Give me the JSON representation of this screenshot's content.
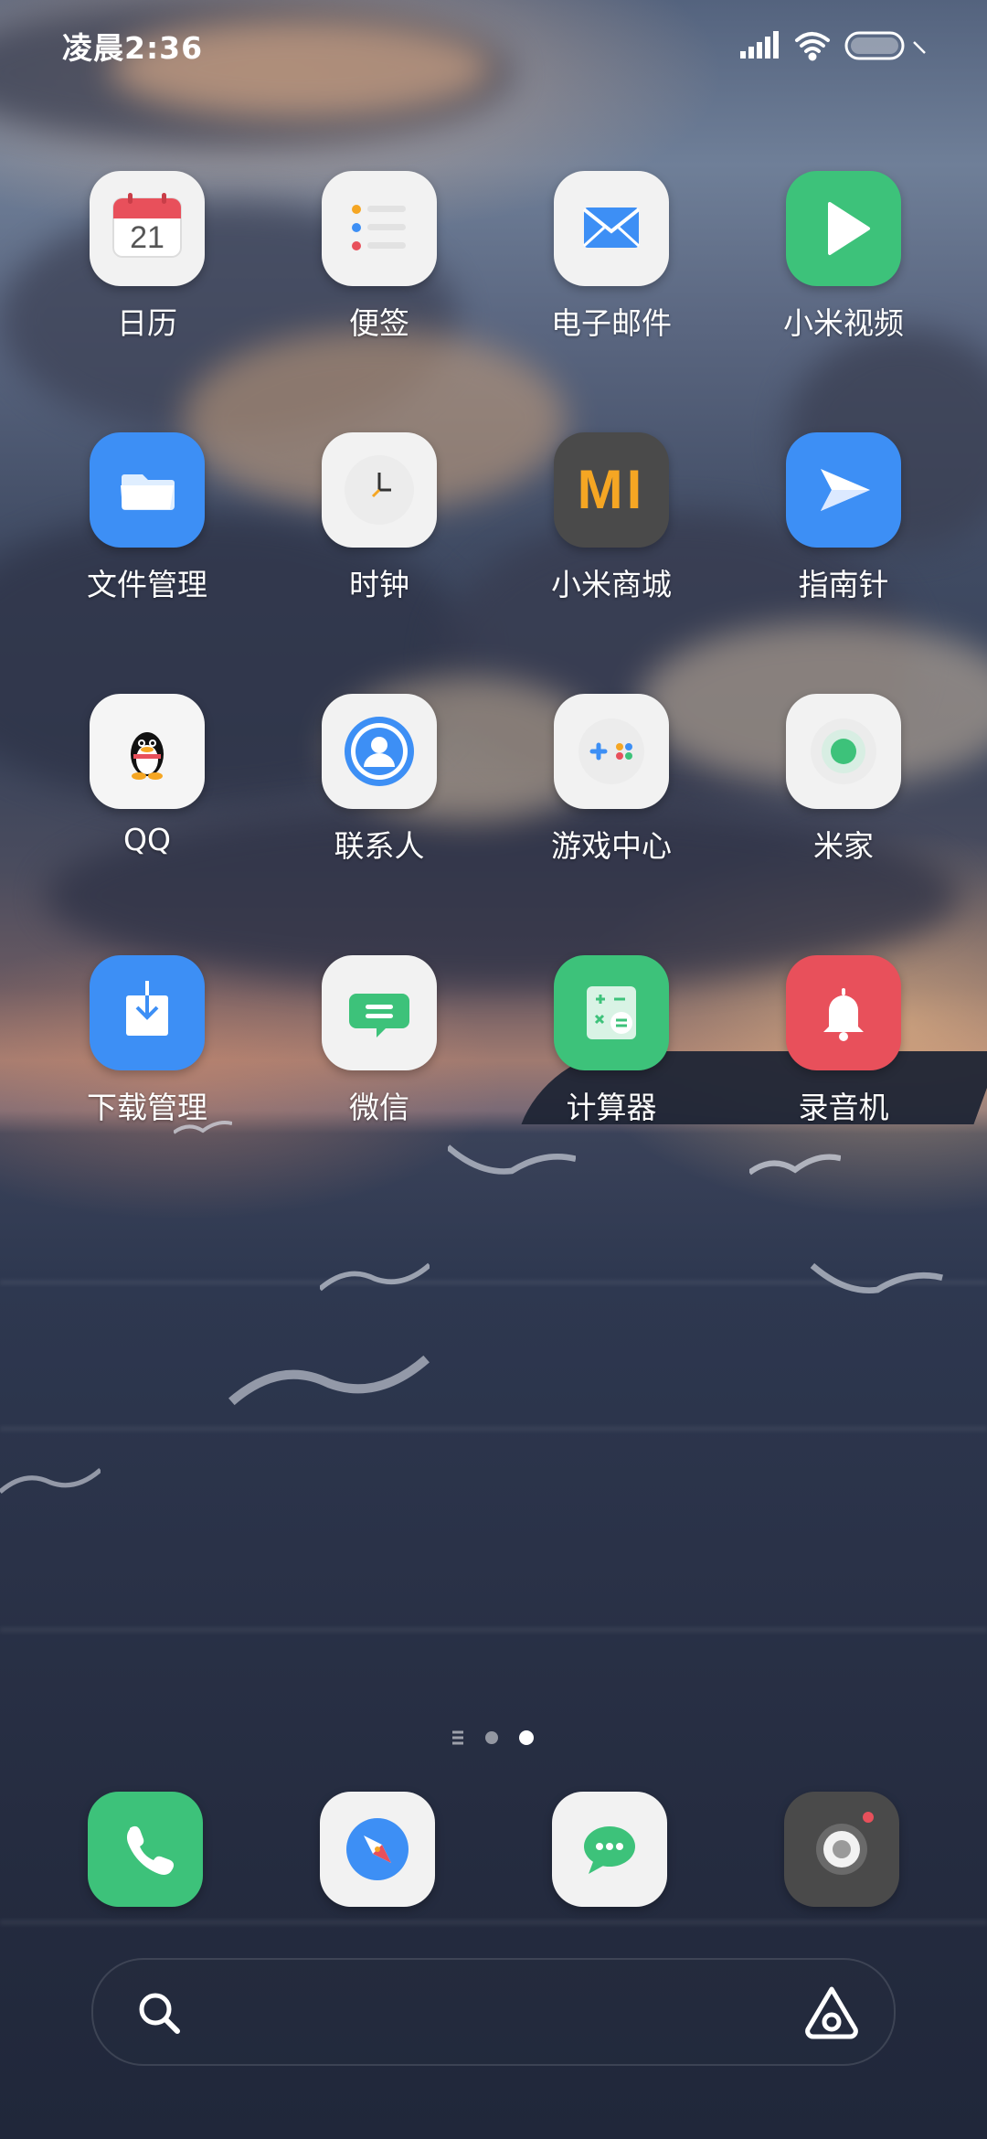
{
  "status_bar": {
    "time": "凌晨2:36"
  },
  "apps": [
    {
      "label": "日历",
      "icon": "calendar-icon",
      "date": "21"
    },
    {
      "label": "便签",
      "icon": "notes-icon"
    },
    {
      "label": "电子邮件",
      "icon": "mail-icon"
    },
    {
      "label": "小米视频",
      "icon": "video-play-icon"
    },
    {
      "label": "文件管理",
      "icon": "folder-icon"
    },
    {
      "label": "时钟",
      "icon": "clock-icon"
    },
    {
      "label": "小米商城",
      "icon": "mi-logo-icon",
      "logo_text": "MI"
    },
    {
      "label": "指南针",
      "icon": "compass-arrow-icon"
    },
    {
      "label": "QQ",
      "icon": "qq-penguin-icon"
    },
    {
      "label": "联系人",
      "icon": "contacts-icon"
    },
    {
      "label": "游戏中心",
      "icon": "gamepad-icon"
    },
    {
      "label": "米家",
      "icon": "mijia-icon"
    },
    {
      "label": "下载管理",
      "icon": "download-icon"
    },
    {
      "label": "微信",
      "icon": "chat-bubble-icon"
    },
    {
      "label": "计算器",
      "icon": "calculator-icon"
    },
    {
      "label": "录音机",
      "icon": "bell-recorder-icon"
    }
  ],
  "dock": [
    {
      "icon": "phone-icon"
    },
    {
      "icon": "browser-compass-icon"
    },
    {
      "icon": "messages-icon"
    },
    {
      "icon": "camera-icon"
    }
  ],
  "page_indicator": {
    "pages": 2,
    "current": 2
  },
  "search": {
    "left_icon": "search-icon",
    "right_icon": "assistant-icon"
  },
  "colors": {
    "calendar_red": "#e8505b",
    "blue": "#3d8ff5",
    "green": "#3dc27a",
    "red": "#e8505b",
    "mi_orange": "#f5a623",
    "dark_gray": "#4a4a4a"
  }
}
